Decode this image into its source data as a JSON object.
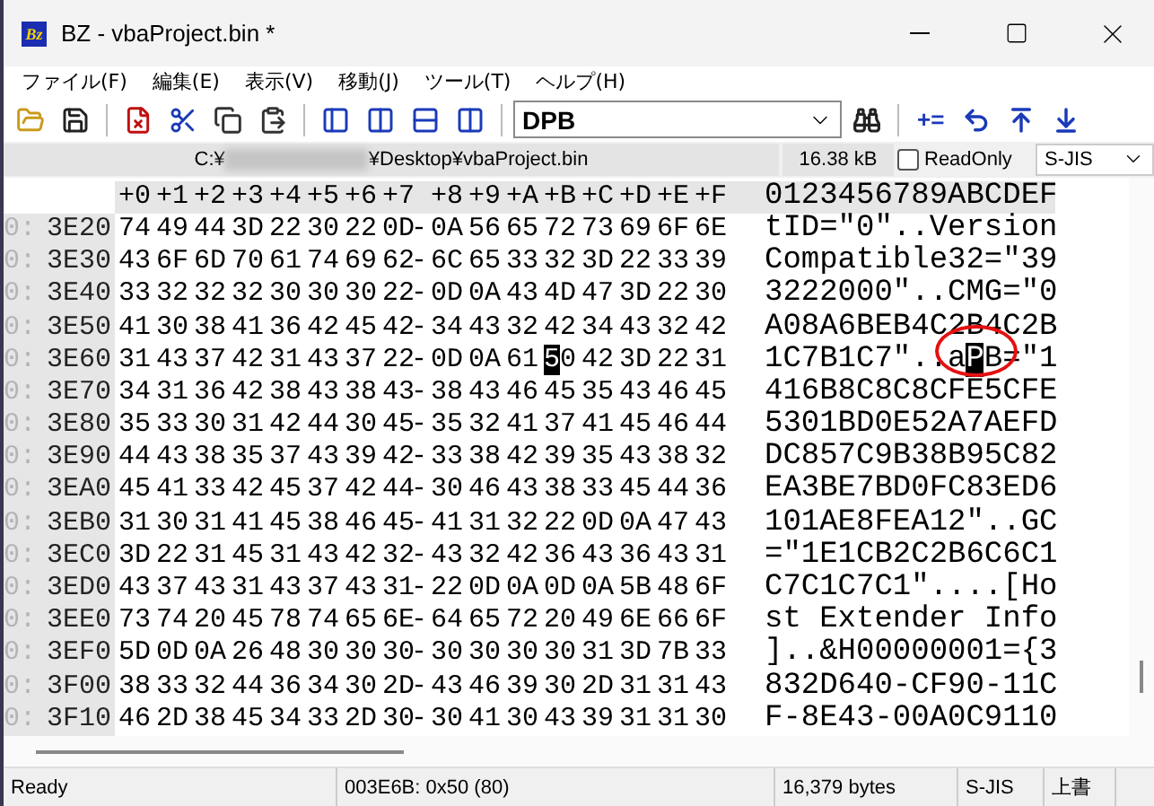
{
  "window": {
    "title": "BZ - vbaProject.bin *",
    "app_icon_text": "Bz"
  },
  "menu": [
    "ファイル(F)",
    "編集(E)",
    "表示(V)",
    "移動(J)",
    "ツール(T)",
    "ヘルプ(H)"
  ],
  "toolbar": {
    "search_value": "DPB",
    "plus_equals": "+="
  },
  "path_bar": {
    "path_start": "C:¥",
    "path_end": "¥Desktop¥vbaProject.bin",
    "size": "16.38 kB",
    "readonly_label": "ReadOnly",
    "readonly_checked": false,
    "encoding": "S-JIS"
  },
  "hex_view": {
    "columns": [
      "+0",
      "+1",
      "+2",
      "+3",
      "+4",
      "+5",
      "+6",
      "+7",
      "+8",
      "+9",
      "+A",
      "+B",
      "+C",
      "+D",
      "+E",
      "+F"
    ],
    "ascii_header": "0123456789ABCDEF",
    "rows": [
      {
        "prefix": "0:",
        "address": "3E20",
        "separator": "-",
        "hex": [
          "74",
          "49",
          "44",
          "3D",
          "22",
          "30",
          "22",
          "0D",
          "0A",
          "56",
          "65",
          "72",
          "73",
          "69",
          "6F",
          "6E"
        ],
        "ascii": "tID=\"0\"..Version"
      },
      {
        "prefix": "0:",
        "address": "3E30",
        "separator": "-",
        "hex": [
          "43",
          "6F",
          "6D",
          "70",
          "61",
          "74",
          "69",
          "62",
          "6C",
          "65",
          "33",
          "32",
          "3D",
          "22",
          "33",
          "39"
        ],
        "ascii": "Compatible32=\"39"
      },
      {
        "prefix": "0:",
        "address": "3E40",
        "separator": "-",
        "hex": [
          "33",
          "32",
          "32",
          "32",
          "30",
          "30",
          "30",
          "22",
          "0D",
          "0A",
          "43",
          "4D",
          "47",
          "3D",
          "22",
          "30"
        ],
        "ascii": "3222000\"..CMG=\"0"
      },
      {
        "prefix": "0:",
        "address": "3E50",
        "separator": "-",
        "hex": [
          "41",
          "30",
          "38",
          "41",
          "36",
          "42",
          "45",
          "42",
          "34",
          "43",
          "32",
          "42",
          "34",
          "43",
          "32",
          "42"
        ],
        "ascii": "A08A6BEB4C2B4C2B"
      },
      {
        "prefix": "0:",
        "address": "3E60",
        "separator": "-",
        "hex": [
          "31",
          "43",
          "37",
          "42",
          "31",
          "43",
          "37",
          "22",
          "0D",
          "0A",
          "61"
        ],
        "cursor": {
          "hex_high": "5",
          "hex_low": "0",
          "char": "P"
        },
        "hex_after": [
          "42",
          "3D",
          "22",
          "31"
        ],
        "ascii": "1C7B1C7\"..a",
        "ascii_after": "B=\"1"
      },
      {
        "prefix": "0:",
        "address": "3E70",
        "separator": "-",
        "hex": [
          "34",
          "31",
          "36",
          "42",
          "38",
          "43",
          "38",
          "43",
          "38",
          "43",
          "46",
          "45",
          "35",
          "43",
          "46",
          "45"
        ],
        "ascii": "416B8C8C8CFE5CFE"
      },
      {
        "prefix": "0:",
        "address": "3E80",
        "separator": "-",
        "hex": [
          "35",
          "33",
          "30",
          "31",
          "42",
          "44",
          "30",
          "45",
          "35",
          "32",
          "41",
          "37",
          "41",
          "45",
          "46",
          "44"
        ],
        "ascii": "5301BD0E52A7AEFD"
      },
      {
        "prefix": "0:",
        "address": "3E90",
        "separator": "-",
        "hex": [
          "44",
          "43",
          "38",
          "35",
          "37",
          "43",
          "39",
          "42",
          "33",
          "38",
          "42",
          "39",
          "35",
          "43",
          "38",
          "32"
        ],
        "ascii": "DC857C9B38B95C82"
      },
      {
        "prefix": "0:",
        "address": "3EA0",
        "separator": "-",
        "hex": [
          "45",
          "41",
          "33",
          "42",
          "45",
          "37",
          "42",
          "44",
          "30",
          "46",
          "43",
          "38",
          "33",
          "45",
          "44",
          "36"
        ],
        "ascii": "EA3BE7BD0FC83ED6"
      },
      {
        "prefix": "0:",
        "address": "3EB0",
        "separator": "-",
        "hex": [
          "31",
          "30",
          "31",
          "41",
          "45",
          "38",
          "46",
          "45",
          "41",
          "31",
          "32",
          "22",
          "0D",
          "0A",
          "47",
          "43"
        ],
        "ascii": "101AE8FEA12\"..GC"
      },
      {
        "prefix": "0:",
        "address": "3EC0",
        "separator": "-",
        "hex": [
          "3D",
          "22",
          "31",
          "45",
          "31",
          "43",
          "42",
          "32",
          "43",
          "32",
          "42",
          "36",
          "43",
          "36",
          "43",
          "31"
        ],
        "ascii": "=\"1E1CB2C2B6C6C1"
      },
      {
        "prefix": "0:",
        "address": "3ED0",
        "separator": "-",
        "hex": [
          "43",
          "37",
          "43",
          "31",
          "43",
          "37",
          "43",
          "31",
          "22",
          "0D",
          "0A",
          "0D",
          "0A",
          "5B",
          "48",
          "6F"
        ],
        "ascii": "C7C1C7C1\"....[Ho"
      },
      {
        "prefix": "0:",
        "address": "3EE0",
        "separator": "-",
        "hex": [
          "73",
          "74",
          "20",
          "45",
          "78",
          "74",
          "65",
          "6E",
          "64",
          "65",
          "72",
          "20",
          "49",
          "6E",
          "66",
          "6F"
        ],
        "ascii": "st Extender Info"
      },
      {
        "prefix": "0:",
        "address": "3EF0",
        "separator": "-",
        "hex": [
          "5D",
          "0D",
          "0A",
          "26",
          "48",
          "30",
          "30",
          "30",
          "30",
          "30",
          "30",
          "30",
          "31",
          "3D",
          "7B",
          "33"
        ],
        "ascii": "]..&H00000001={3"
      },
      {
        "prefix": "0:",
        "address": "3F00",
        "separator": "-",
        "hex": [
          "38",
          "33",
          "32",
          "44",
          "36",
          "34",
          "30",
          "2D",
          "43",
          "46",
          "39",
          "30",
          "2D",
          "31",
          "31",
          "43"
        ],
        "ascii": "832D640-CF90-11C"
      },
      {
        "prefix": "0:",
        "address": "3F10",
        "separator": "-",
        "hex": [
          "46",
          "2D",
          "38",
          "45",
          "34",
          "33",
          "2D",
          "30",
          "30",
          "41",
          "30",
          "43",
          "39",
          "31",
          "31",
          "30"
        ],
        "ascii": "F-8E43-00A0C9110"
      }
    ]
  },
  "status_bar": {
    "message": "Ready",
    "position": "003E6B: 0x50 (80)",
    "file_size": "16,379 bytes",
    "encoding": "S-JIS",
    "mode": "上書"
  }
}
